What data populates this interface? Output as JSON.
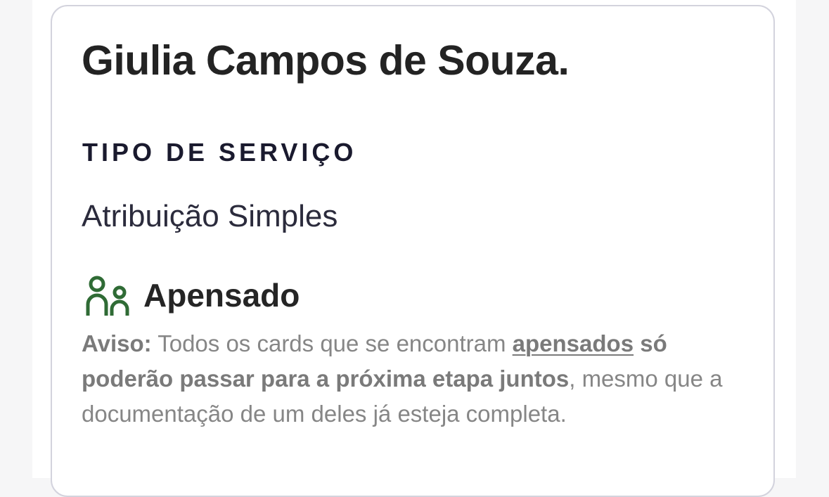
{
  "card": {
    "title": "Giulia Campos de Souza.",
    "service_type_label": "TIPO DE SERVIÇO",
    "service_type_value": "Atribuição Simples",
    "apensado": {
      "icon": "people-icon",
      "label": "Apensado",
      "icon_color": "#2f6b35"
    },
    "warning": {
      "prefix": "Aviso:",
      "text_1": " Todos os cards que se encontram ",
      "link": "apensados",
      "text_2": " ",
      "bold": "só poderão passar para a próxima etapa juntos",
      "text_3": ", mesmo que a documentação de um deles já esteja completa."
    }
  }
}
